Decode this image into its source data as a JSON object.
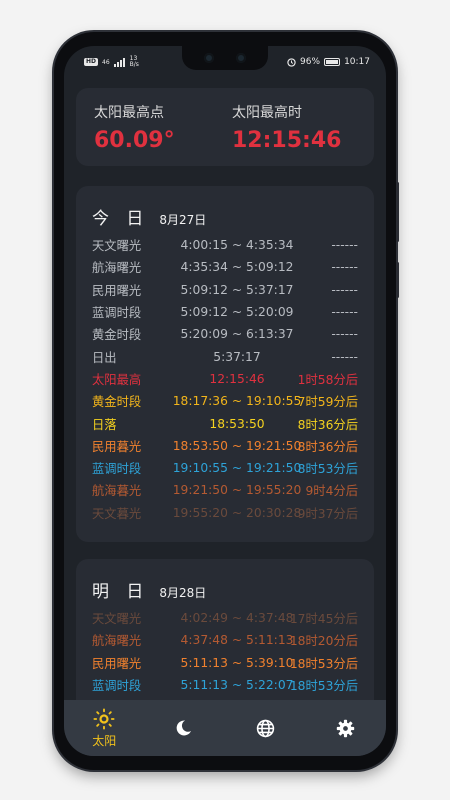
{
  "status": {
    "network": "46",
    "speed_value": "13",
    "speed_unit": "B/s",
    "battery_percent": "96%",
    "time": "10:17",
    "battery_level": 0.96
  },
  "summary": {
    "max_elevation_label": "太阳最高点",
    "max_elevation_value": "60.09°",
    "max_time_label": "太阳最高时",
    "max_time_value": "12:15:46"
  },
  "today": {
    "title": "今 日",
    "date": "8月27日",
    "rows": [
      {
        "label": "天文曙光",
        "time": "4:00:15 ~ 4:35:34",
        "rel": "------",
        "color": "#b8bcc2"
      },
      {
        "label": "航海曙光",
        "time": "4:35:34 ~ 5:09:12",
        "rel": "------",
        "color": "#b8bcc2"
      },
      {
        "label": "民用曙光",
        "time": "5:09:12 ~ 5:37:17",
        "rel": "------",
        "color": "#b8bcc2"
      },
      {
        "label": "蓝调时段",
        "time": "5:09:12 ~ 5:20:09",
        "rel": "------",
        "color": "#b8bcc2"
      },
      {
        "label": "黄金时段",
        "time": "5:20:09 ~ 6:13:37",
        "rel": "------",
        "color": "#b8bcc2"
      },
      {
        "label": "日出",
        "time": "5:37:17",
        "rel": "------",
        "color": "#b8bcc2"
      },
      {
        "label": "太阳最高",
        "time": "12:15:46",
        "rel": "1时58分后",
        "color": "#e0313f"
      },
      {
        "label": "黄金时段",
        "time": "18:17:36 ~ 19:10:55",
        "rel": "7时59分后",
        "color": "#f2b51b"
      },
      {
        "label": "日落",
        "time": "18:53:50",
        "rel": "8时36分后",
        "color": "#f5d21f"
      },
      {
        "label": "民用暮光",
        "time": "18:53:50 ~ 19:21:50",
        "rel": "8时36分后",
        "color": "#f0812e"
      },
      {
        "label": "蓝调时段",
        "time": "19:10:55 ~ 19:21:50",
        "rel": "8时53分后",
        "color": "#2ea3d8"
      },
      {
        "label": "航海暮光",
        "time": "19:21:50 ~ 19:55:20",
        "rel": "9时4分后",
        "color": "#b45a32"
      },
      {
        "label": "天文暮光",
        "time": "19:55:20 ~ 20:30:28",
        "rel": "9时37分后",
        "color": "#6a4a3c"
      }
    ]
  },
  "tomorrow": {
    "title": "明 日",
    "date": "8月28日",
    "rows": [
      {
        "label": "天文曙光",
        "time": "4:02:49 ~ 4:37:48",
        "rel": "17时45分后",
        "color": "#6a4a3c"
      },
      {
        "label": "航海曙光",
        "time": "4:37:48 ~ 5:11:13",
        "rel": "18时20分后",
        "color": "#b45a32"
      },
      {
        "label": "民用曙光",
        "time": "5:11:13 ~ 5:39:10",
        "rel": "18时53分后",
        "color": "#f0812e"
      },
      {
        "label": "蓝调时段",
        "time": "5:11:13 ~ 5:22:07",
        "rel": "18时53分后",
        "color": "#2ea3d8"
      }
    ]
  },
  "nav": {
    "sun_label": "太阳",
    "active_color": "#f2c21b",
    "icons": [
      "sun-icon",
      "moon-icon",
      "globe-icon",
      "gear-icon"
    ]
  }
}
